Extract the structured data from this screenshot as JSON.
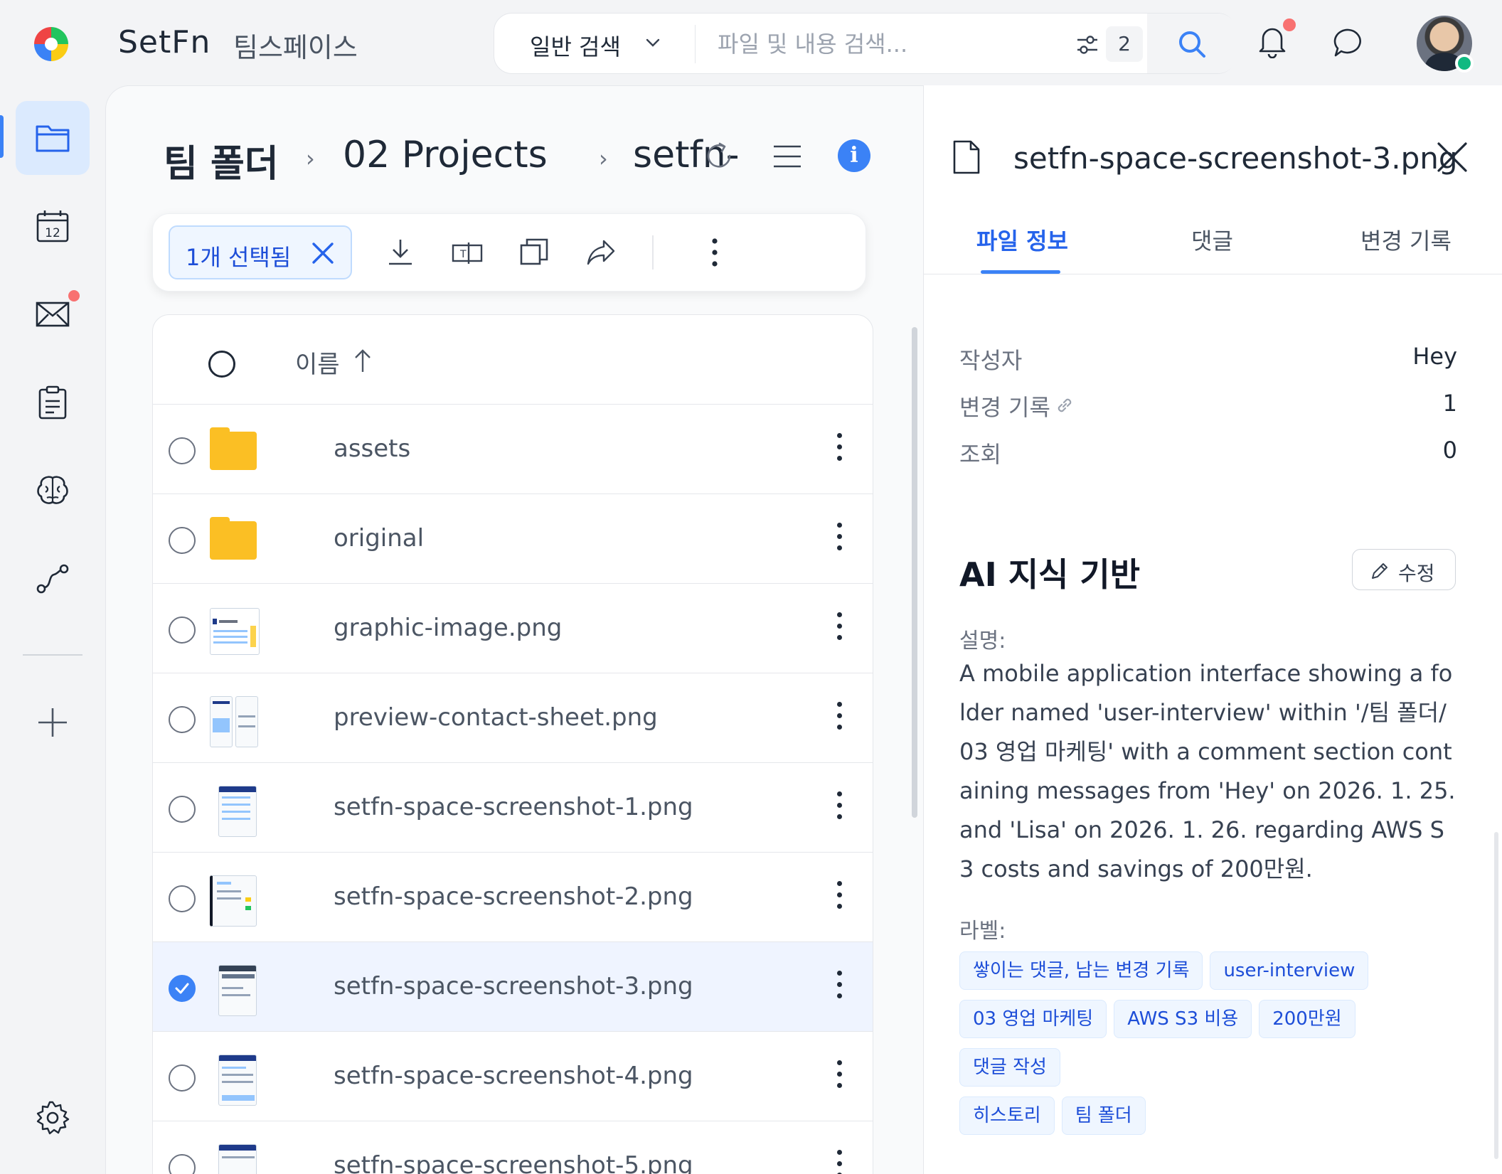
{
  "header": {
    "brand": "SetFn",
    "workspace": "팀스페이스",
    "search_mode": "일반 검색",
    "search_placeholder": "파일 및 내용 검색...",
    "filter_count": "2"
  },
  "colors": {
    "accent": "#3b82f6",
    "selected_row": "#eff4ff",
    "folder": "#fbbf24",
    "notification_dot": "#f87171",
    "online": "#10b981"
  },
  "rail": {
    "items": [
      {
        "name": "folder-icon",
        "active": true
      },
      {
        "name": "calendar-icon",
        "label": "12"
      },
      {
        "name": "mail-icon"
      },
      {
        "name": "clipboard-icon"
      },
      {
        "name": "brain-icon"
      },
      {
        "name": "workflow-icon"
      },
      {
        "name": "plus-icon"
      },
      {
        "name": "gear-icon"
      }
    ]
  },
  "breadcrumb": {
    "items": [
      "팀 폴더",
      "02 Projects",
      "setfn-sp"
    ]
  },
  "toolbar": {
    "selected_label": "1개 선택됨"
  },
  "list": {
    "header": "이름",
    "rows": [
      {
        "name": "assets",
        "type": "folder",
        "selected": false
      },
      {
        "name": "original",
        "type": "folder",
        "selected": false
      },
      {
        "name": "graphic-image.png",
        "type": "image",
        "selected": false
      },
      {
        "name": "preview-contact-sheet.png",
        "type": "image",
        "selected": false
      },
      {
        "name": "setfn-space-screenshot-1.png",
        "type": "image",
        "selected": false
      },
      {
        "name": "setfn-space-screenshot-2.png",
        "type": "image",
        "selected": false
      },
      {
        "name": "setfn-space-screenshot-3.png",
        "type": "image",
        "selected": true
      },
      {
        "name": "setfn-space-screenshot-4.png",
        "type": "image",
        "selected": false
      },
      {
        "name": "setfn-space-screenshot-5.png",
        "type": "image",
        "selected": false
      }
    ]
  },
  "panel": {
    "title": "setfn-space-screenshot-3.png",
    "tabs": [
      "파일 정보",
      "댓글",
      "변경 기록"
    ],
    "meta": [
      {
        "label": "작성자",
        "value": "Hey"
      },
      {
        "label": "변경 기록",
        "value": "1"
      },
      {
        "label": "조회",
        "value": "0"
      }
    ],
    "ai_title": "AI 지식 기반",
    "edit_label": "수정",
    "desc_label": "설명:",
    "description": "A mobile application interface showing a folder named 'user-interview' within '/팀 폴더/03 영업 마케팅' with a comment section containing messages from 'Hey' on 2026. 1. 25. and 'Lisa' on 2026. 1. 26. regarding AWS S3 costs and savings of 200만원.",
    "labels_label": "라벨:",
    "labels": [
      "쌓이는 댓글, 남는 변경 기록",
      "user-interview",
      "03 영업 마케팅",
      "AWS S3 비용",
      "200만원",
      "댓글 작성",
      "히스토리",
      "팀 폴더"
    ]
  }
}
